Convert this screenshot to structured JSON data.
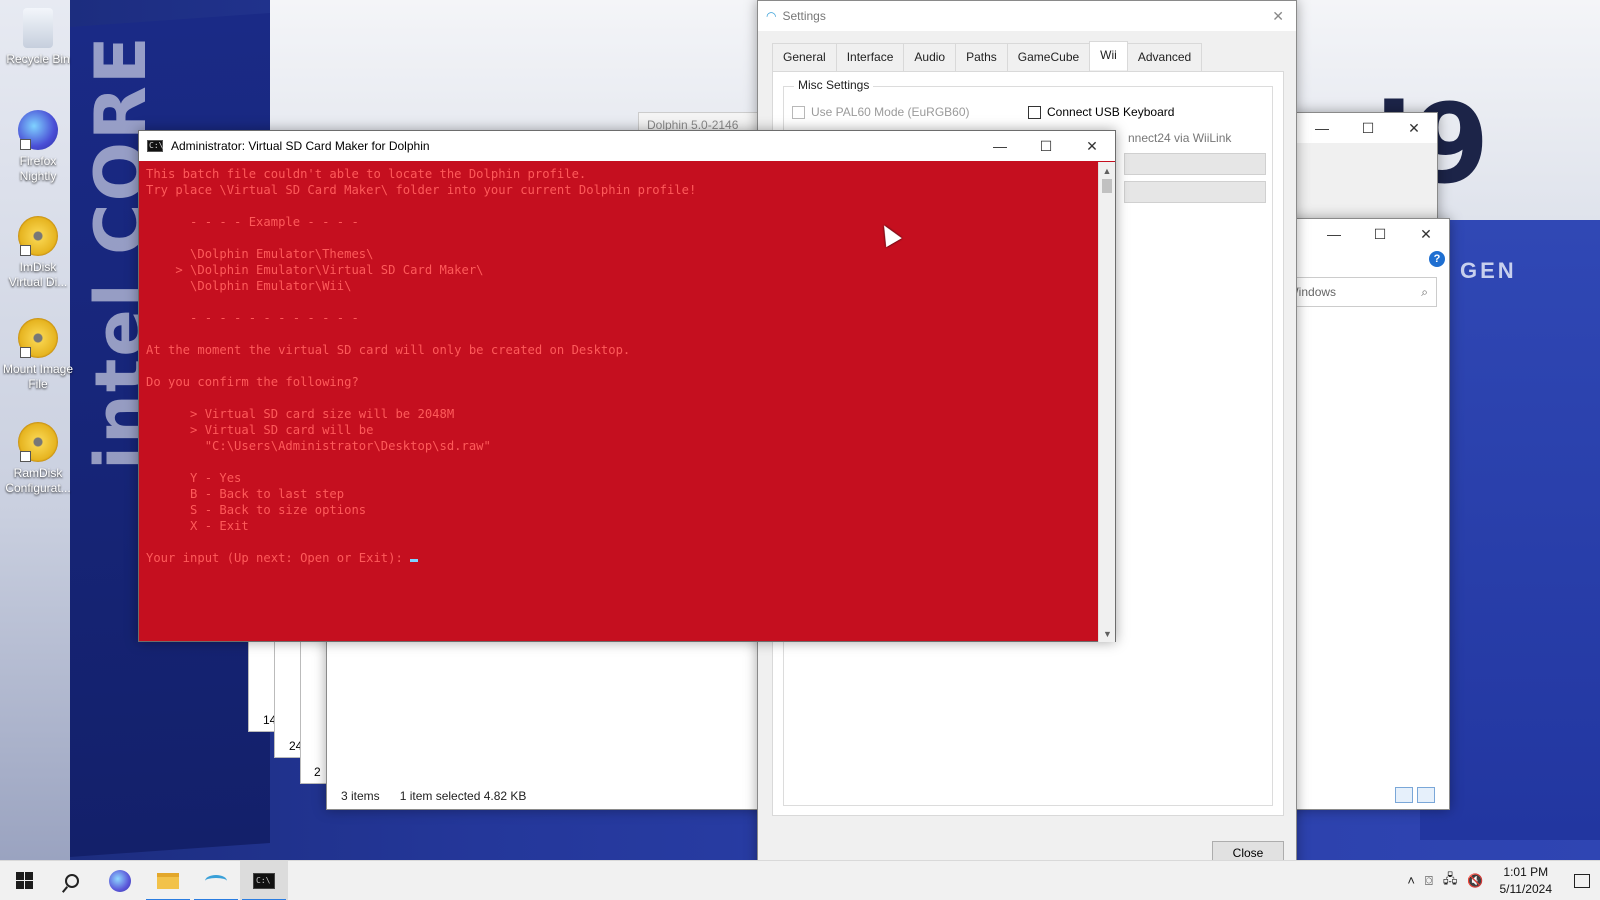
{
  "desktop": {
    "wallpaper_brand": "intel CORE",
    "wallpaper_model": "i9",
    "wallpaper_gen": "GEN",
    "icons": [
      {
        "label": "Recycle Bin"
      },
      {
        "label": "Firefox Nightly"
      },
      {
        "label": "ImDisk Virtual Di..."
      },
      {
        "label": "Mount Image File"
      },
      {
        "label": "RamDisk Configurat..."
      }
    ]
  },
  "settings": {
    "title": "Settings",
    "tabs": [
      "General",
      "Interface",
      "Audio",
      "Paths",
      "GameCube",
      "Wii",
      "Advanced"
    ],
    "active_tab": "Wii",
    "group_title": "Misc Settings",
    "options": {
      "pal60": "Use PAL60 Mode (EuRGB60)",
      "usb_keyboard": "Connect USB Keyboard",
      "wiilink": "nnect24 via WiiLink"
    },
    "close_label": "Close"
  },
  "dolphin_main": {
    "title": "Dolphin 5.0-2146"
  },
  "explorer": {
    "search_placeholder": "Search Windows",
    "status_items": "3 items",
    "status_selected": "1 item selected  4.82 KB",
    "stack_labels": [
      "14",
      "24",
      "2"
    ]
  },
  "console": {
    "title": "Administrator:  Virtual SD Card Maker for Dolphin",
    "lines": [
      "This batch file couldn't able to locate the Dolphin profile.",
      "Try place \\Virtual SD Card Maker\\ folder into your current Dolphin profile!",
      "",
      "      - - - - Example - - - -",
      "",
      "      \\Dolphin Emulator\\Themes\\",
      "    > \\Dolphin Emulator\\Virtual SD Card Maker\\",
      "      \\Dolphin Emulator\\Wii\\",
      "",
      "      - - - - - - - - - - - -",
      "",
      "At the moment the virtual SD card will only be created on Desktop.",
      "",
      "Do you confirm the following?",
      "",
      "      > Virtual SD card size will be 2048M",
      "      > Virtual SD card will be",
      "        \"C:\\Users\\Administrator\\Desktop\\sd.raw\"",
      "",
      "      Y - Yes",
      "      B - Back to last step",
      "      S - Back to size options",
      "      X - Exit",
      ""
    ],
    "prompt": "Your input (Up next: Open or Exit): "
  },
  "taskbar": {
    "time": "1:01 PM",
    "date": "5/11/2024"
  },
  "colors": {
    "console_bg": "#c50f1f",
    "console_text": "#ff5a5a",
    "cursor": "#7fd3ff"
  }
}
